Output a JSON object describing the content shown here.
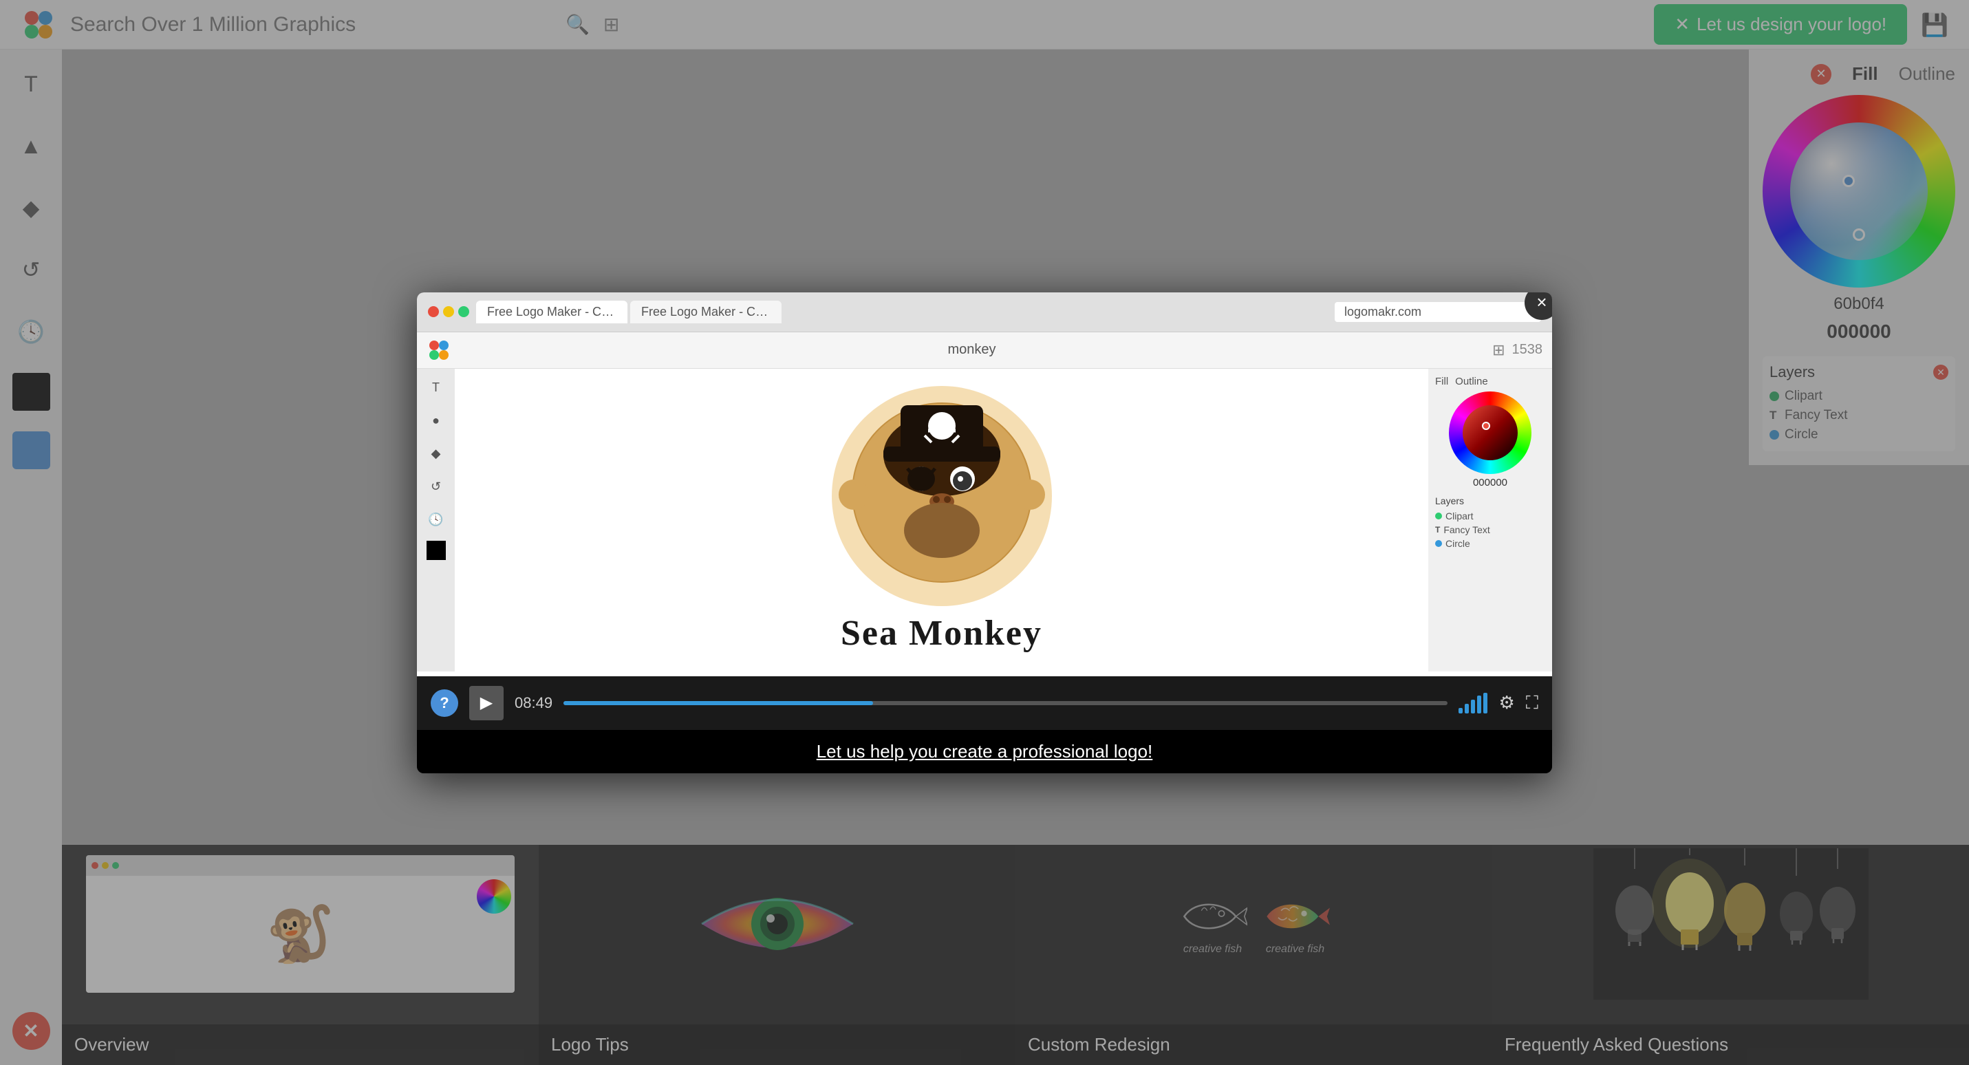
{
  "topbar": {
    "search_placeholder": "Search Over 1 Million Graphics",
    "design_btn_label": "Let us design your logo!",
    "save_icon": "💾"
  },
  "fill_outline": {
    "fill_label": "Fill",
    "outline_label": "Outline",
    "hex_label": "60b0f4",
    "hex_value": "000000"
  },
  "layers": {
    "title": "Layers",
    "items": [
      {
        "type": "dot",
        "color": "green",
        "label": "Clipart"
      },
      {
        "type": "T",
        "label": "Fancy Text"
      },
      {
        "type": "dot",
        "color": "blue",
        "label": "Circle"
      }
    ]
  },
  "video_modal": {
    "close_label": "×",
    "browser_tab1": "Free Logo Maker - Create yo...",
    "browser_tab2": "Free Logo Maker - Create yo...",
    "address": "logomakr.com",
    "inner_search": "monkey",
    "inner_number": "1538",
    "sea_monkey_text": "Sea Monkey",
    "timestamp": "08:49",
    "subtitle": "Let us help you create a professional logo!"
  },
  "thumbnails": [
    {
      "label": "Overview"
    },
    {
      "label": "Logo Tips"
    },
    {
      "label": "Custom Redesign"
    },
    {
      "label": "Frequently Asked Questions"
    }
  ],
  "fish_labels": {
    "fish1": "creative fish",
    "fish2": "creative fish"
  }
}
